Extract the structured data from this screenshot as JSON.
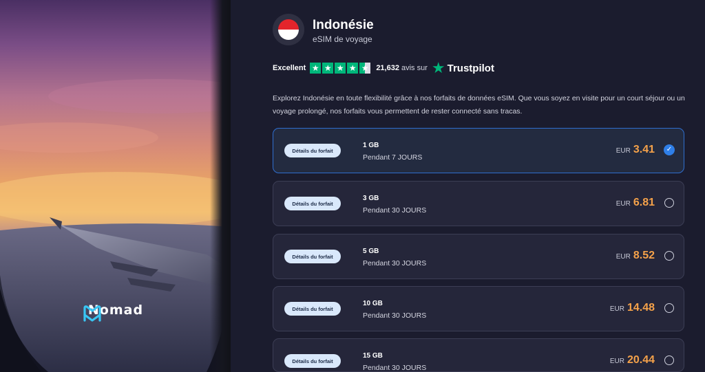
{
  "brand": {
    "name": "Nomad",
    "logo_icon": "nomad-logo-icon"
  },
  "country": {
    "name": "Indonésie",
    "subtitle": "eSIM de voyage",
    "flag_icon": "indonesia-flag-icon",
    "flag_colors": [
      "#e3242b",
      "#ffffff"
    ]
  },
  "trustpilot": {
    "rating_label": "Excellent",
    "stars": 4.5,
    "star_glyph": "★",
    "review_count": "21,632",
    "review_suffix": "avis sur",
    "brand": "Trustpilot",
    "accent": "#00b67a"
  },
  "description": "Explorez Indonésie en toute flexibilité grâce à nos forfaits de données eSIM. Que vous soyez en visite pour un court séjour ou un voyage prolongé, nos forfaits vous permettent de rester connecté sans tracas.",
  "plans": [
    {
      "details_label": "Détails du forfait",
      "data": "1 GB",
      "duration": "Pendant 7 JOURS",
      "currency": "EUR",
      "price": "3.41",
      "selected": true,
      "check_glyph": "✓"
    },
    {
      "details_label": "Détails du forfait",
      "data": "3 GB",
      "duration": "Pendant 30 JOURS",
      "currency": "EUR",
      "price": "6.81",
      "selected": false
    },
    {
      "details_label": "Détails du forfait",
      "data": "5 GB",
      "duration": "Pendant 30 JOURS",
      "currency": "EUR",
      "price": "8.52",
      "selected": false
    },
    {
      "details_label": "Détails du forfait",
      "data": "10 GB",
      "duration": "Pendant 30 JOURS",
      "currency": "EUR",
      "price": "14.48",
      "selected": false
    },
    {
      "details_label": "Détails du forfait",
      "data": "15 GB",
      "duration": "Pendant 30 JOURS",
      "currency": "EUR",
      "price": "20.44",
      "selected": false
    }
  ],
  "colors": {
    "price_accent": "#f5a24a",
    "selected_border": "#2f6fd0",
    "radio_checked": "#2f7fe8"
  }
}
